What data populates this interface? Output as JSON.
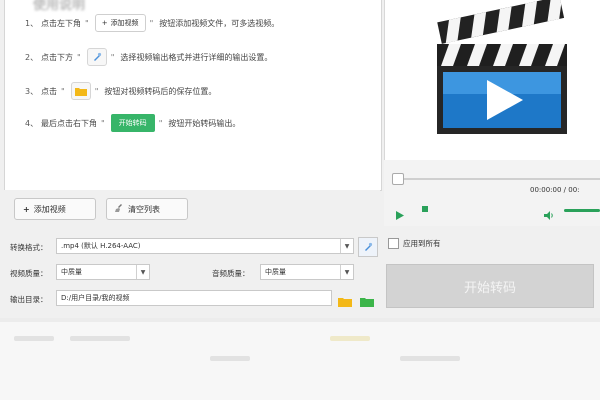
{
  "instructions": {
    "heading": "使用说明",
    "steps": [
      {
        "num": "1、",
        "before": "点击左下角",
        "button": "添加视频",
        "after": "按钮添加视频文件，可多选视频。"
      },
      {
        "num": "2、",
        "before": "点击下方",
        "after": "选择视频输出格式并进行详细的输出设置。"
      },
      {
        "num": "3、",
        "before": "点击",
        "after": "按钮对视频转码后的保存位置。"
      },
      {
        "num": "4、",
        "before": "最后点击右下角",
        "button": "开始转码",
        "after": "按钮开始转码输出。"
      }
    ]
  },
  "buttons": {
    "add_video": "添加视频",
    "clear_list": "清空列表",
    "start": "开始转码"
  },
  "player": {
    "time": "00:00:00 / 00:"
  },
  "settings": {
    "format_label": "转换格式：",
    "format_value": ".mp4 (默认 H.264-AAC)",
    "video_quality_label": "视频质量：",
    "video_quality_value": "中质量",
    "audio_quality_label": "音频质量：",
    "audio_quality_value": "中质量",
    "output_label": "输出目录：",
    "output_value": "D:/用户目录/我的视频",
    "apply_all": "应用到所有"
  },
  "colors": {
    "accent_green": "#37b569",
    "play_blue": "#1e78c8"
  },
  "icons": {
    "add": "plus-icon",
    "clear": "broom-icon",
    "settings": "settings-icon",
    "folder": "folder-icon",
    "play": "play-icon",
    "stop": "stop-icon",
    "volume": "volume-icon"
  }
}
